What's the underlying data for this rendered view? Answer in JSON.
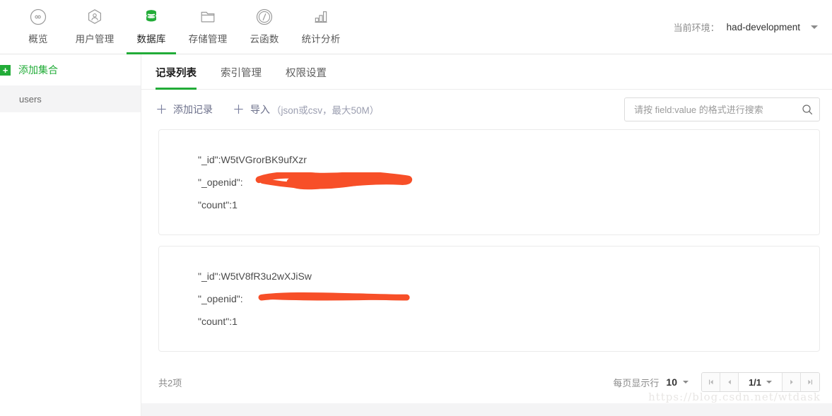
{
  "topnav": {
    "items": [
      {
        "label": "概览",
        "icon": "infinity-circle-icon",
        "active": false
      },
      {
        "label": "用户管理",
        "icon": "user-hexagon-icon",
        "active": false
      },
      {
        "label": "数据库",
        "icon": "database-icon",
        "active": true
      },
      {
        "label": "存储管理",
        "icon": "folder-icon",
        "active": false
      },
      {
        "label": "云函数",
        "icon": "cloud-function-icon",
        "active": false
      },
      {
        "label": "统计分析",
        "icon": "bar-chart-icon",
        "active": false
      }
    ],
    "env_label": "当前环境：",
    "env_value": "had-development"
  },
  "sidebar": {
    "add_collection_label": "添加集合",
    "add_icon": "plus-square-icon",
    "collections": [
      {
        "name": "users",
        "selected": true
      }
    ]
  },
  "tabs": [
    {
      "label": "记录列表",
      "active": true
    },
    {
      "label": "索引管理",
      "active": false
    },
    {
      "label": "权限设置",
      "active": false
    }
  ],
  "toolbar": {
    "add_record_label": "添加记录",
    "import_label": "导入",
    "import_note": "（json或csv，最大50M）",
    "plus_glyph": "＋"
  },
  "search": {
    "value": "",
    "placeholder": "请按 field:value 的格式进行搜索",
    "icon": "search-icon"
  },
  "records": [
    {
      "id_line": "\"_id\":W5tVGrorBK9ufXzr",
      "openid_key": "\"_openid\":",
      "openid_value_redacted": true,
      "count_line": "\"count\":1"
    },
    {
      "id_line": "\"_id\":W5tV8fR3u2wXJiSw",
      "openid_key": "\"_openid\":",
      "openid_value_redacted": true,
      "count_line": "\"count\":1"
    }
  ],
  "footer": {
    "total_text": "共2项",
    "page_size_label": "每页显示行",
    "page_size_value": "10",
    "page_indicator": "1/1",
    "first_page_glyph": "◀|",
    "prev_page_glyph": "◀",
    "next_page_glyph": "▶",
    "last_page_glyph": "|▶"
  },
  "watermark": "https://blog.csdn.net/wtdask",
  "colors": {
    "accent_green": "#22ac38",
    "redaction_orange": "#f74f28",
    "panel_bg": "#f4f4f5",
    "border": "#e6e6e6"
  }
}
